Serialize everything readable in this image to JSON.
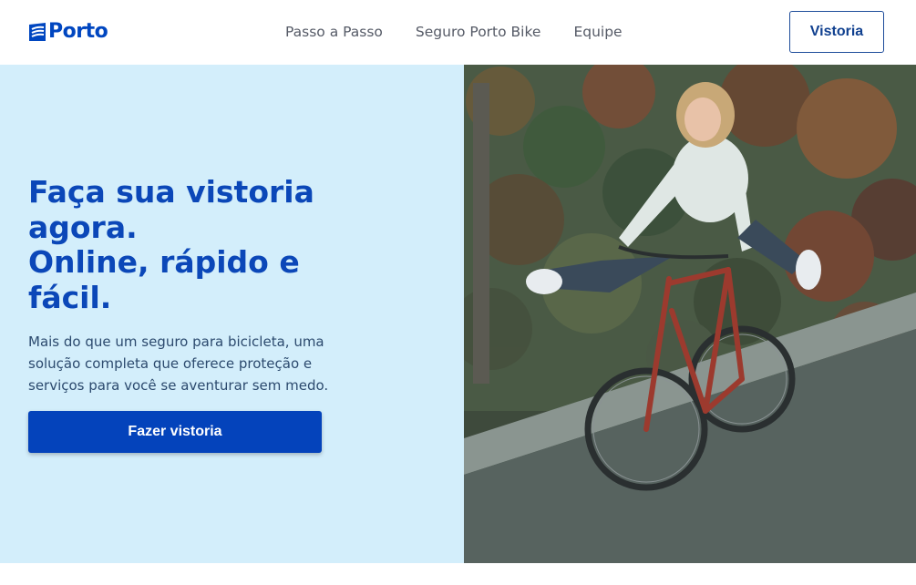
{
  "brand": {
    "name": "Porto",
    "color": "#0046c0"
  },
  "nav": {
    "items": [
      {
        "label": "Passo a Passo"
      },
      {
        "label": "Seguro Porto Bike"
      },
      {
        "label": "Equipe"
      }
    ],
    "cta_label": "Vistoria"
  },
  "hero": {
    "title_lines": [
      "Faça sua vistoria",
      "agora.",
      "Online, rápido e",
      "fácil."
    ],
    "description": "Mais do que um seguro para bicicleta, uma solução completa que oferece proteção e serviços para você se aventurar sem medo.",
    "button_label": "Fazer vistoria",
    "background_color": "#d3eefb",
    "accent_color": "#0443bb"
  }
}
